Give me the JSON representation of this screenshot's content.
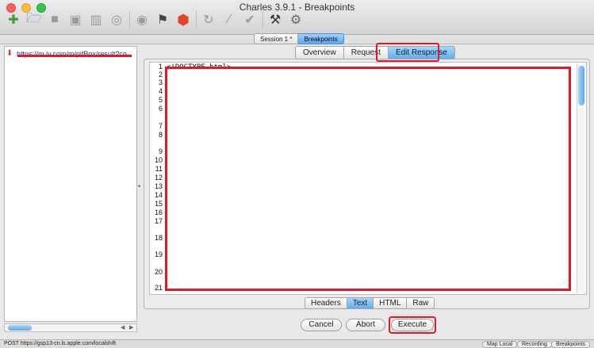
{
  "window": {
    "title": "Charles 3.9.1 - Breakpoints"
  },
  "toolbar": {
    "icons": [
      "new-session-icon",
      "open-icon",
      "folder-icon",
      "save-icon",
      "trash-icon",
      "binoculars-icon",
      "record-icon",
      "throttle-icon",
      "breakpoints-stop-icon",
      "repeat-icon",
      "edit-icon",
      "validate-icon",
      "tools-icon",
      "settings-gear-icon"
    ]
  },
  "session_tabs": [
    {
      "label": "Session 1 *",
      "active": false
    },
    {
      "label": "Breakpoints",
      "active": true
    }
  ],
  "tree": {
    "first_item": "https://m.iv.com/m/pifBox/result?co"
  },
  "view_tabs": [
    {
      "label": "Overview",
      "active": false
    },
    {
      "label": "Request",
      "active": false
    },
    {
      "label": "Edit Response",
      "active": true
    }
  ],
  "editor": {
    "first_line": "<!DOCTYPE html>",
    "line_numbers": [
      "1",
      "2",
      "3",
      "4",
      "5",
      "6",
      "7",
      "8",
      "9",
      "10",
      "11",
      "12",
      "13",
      "14",
      "15",
      "16",
      "17",
      "18",
      "19",
      "20",
      "21"
    ]
  },
  "bottom_tabs": [
    {
      "label": "Headers",
      "active": false
    },
    {
      "label": "Text",
      "active": true
    },
    {
      "label": "HTML",
      "active": false
    },
    {
      "label": "Raw",
      "active": false
    }
  ],
  "actions": {
    "cancel": "Cancel",
    "abort": "Abort",
    "execute": "Execute"
  },
  "status": {
    "text": "POST https://gsp13-cn.ls.apple.com/localshift",
    "pills": [
      "Map Local",
      "Recording",
      "Breakpoints"
    ]
  },
  "colors": {
    "accent": "#5aa9ef",
    "highlight_red": "#e0192a"
  }
}
